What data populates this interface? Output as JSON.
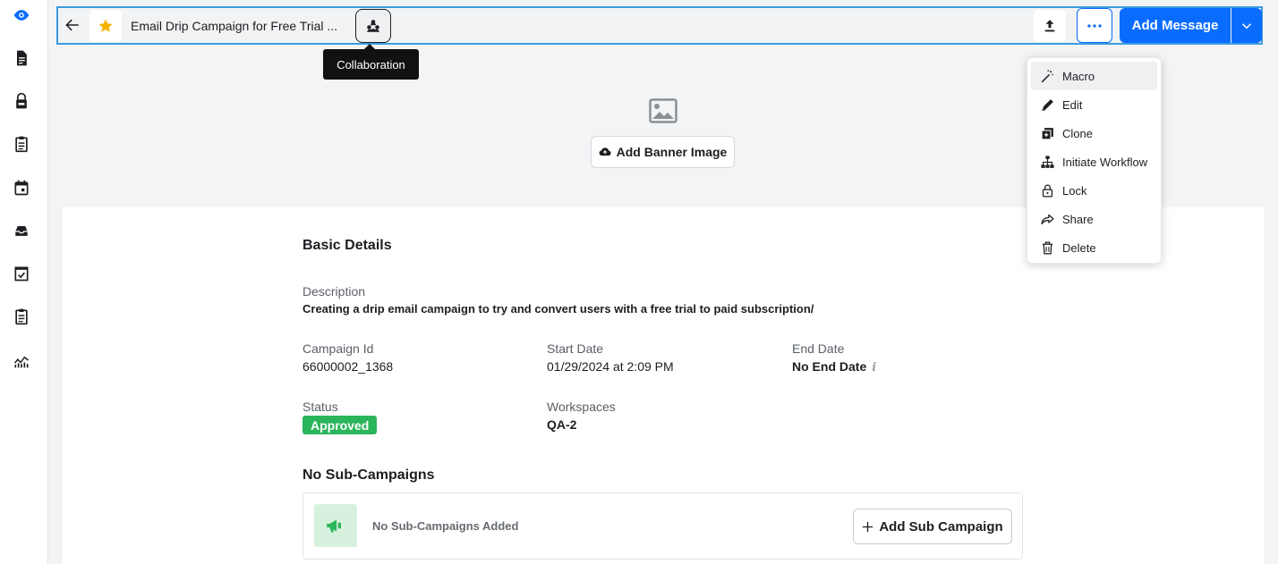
{
  "header": {
    "title": "Email Drip Campaign for Free Trial ...",
    "collaboration_tooltip": "Collaboration",
    "add_message_label": "Add Message"
  },
  "banner": {
    "add_banner_label": "Add Banner Image"
  },
  "details": {
    "section_title": "Basic Details",
    "description_label": "Description",
    "description_value": "Creating a drip email campaign to try and convert users with a free trial to paid subscription/",
    "campaign_id_label": "Campaign Id",
    "campaign_id_value": "66000002_1368",
    "start_date_label": "Start Date",
    "start_date_value": "01/29/2024 at 2:09 PM",
    "end_date_label": "End Date",
    "end_date_value": "No End Date",
    "info_glyph": "i",
    "status_label": "Status",
    "status_value": "Approved",
    "workspaces_label": "Workspaces",
    "workspaces_value": "QA-2"
  },
  "subcampaigns": {
    "section_title": "No Sub-Campaigns",
    "empty_text": "No Sub-Campaigns Added",
    "add_label": "Add Sub Campaign"
  },
  "menu": {
    "items": [
      {
        "label": "Macro",
        "icon": "magic-wand-icon"
      },
      {
        "label": "Edit",
        "icon": "pencil-icon"
      },
      {
        "label": "Clone",
        "icon": "clone-icon"
      },
      {
        "label": "Initiate Workflow",
        "icon": "workflow-icon"
      },
      {
        "label": "Lock",
        "icon": "lock-icon"
      },
      {
        "label": "Share",
        "icon": "share-icon"
      },
      {
        "label": "Delete",
        "icon": "trash-icon"
      }
    ]
  },
  "colors": {
    "primary": "#0a6cff",
    "status_approved": "#2bb55a",
    "focus_border": "#3a9be0"
  }
}
